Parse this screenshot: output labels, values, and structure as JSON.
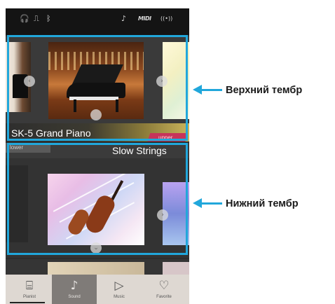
{
  "status_bar": {
    "icons": [
      "headphones-icon",
      "usb-icon",
      "bluetooth-icon",
      "audio-icon",
      "midi-icon",
      "wireless-icon"
    ],
    "glyphs": {
      "headphones": "🎧",
      "usb": "⎍",
      "bluetooth": "ᛒ",
      "audio": "♪",
      "midi": "MIDI",
      "wireless": "((•))"
    }
  },
  "upper_section": {
    "title": "SK-5 Grand Piano",
    "tag": "upper"
  },
  "lower_section": {
    "title": "Slow Strings",
    "tag": "lower"
  },
  "nav": {
    "items": [
      {
        "label": "Pianist",
        "icon": "piano-icon",
        "glyph": "⌸"
      },
      {
        "label": "Sound",
        "icon": "music-note-icon",
        "glyph": "♪"
      },
      {
        "label": "Music",
        "icon": "play-icon",
        "glyph": "▷"
      },
      {
        "label": "Favorite",
        "icon": "heart-icon",
        "glyph": "♡"
      }
    ],
    "active": "Sound"
  },
  "callouts": {
    "upper": "Верхний тембр",
    "lower": "Нижний тембр"
  },
  "colors": {
    "highlight": "#21a7db",
    "upper_tag": "#c7345a",
    "nav_background": "#ded8d2",
    "nav_active": "#7f7b78"
  }
}
